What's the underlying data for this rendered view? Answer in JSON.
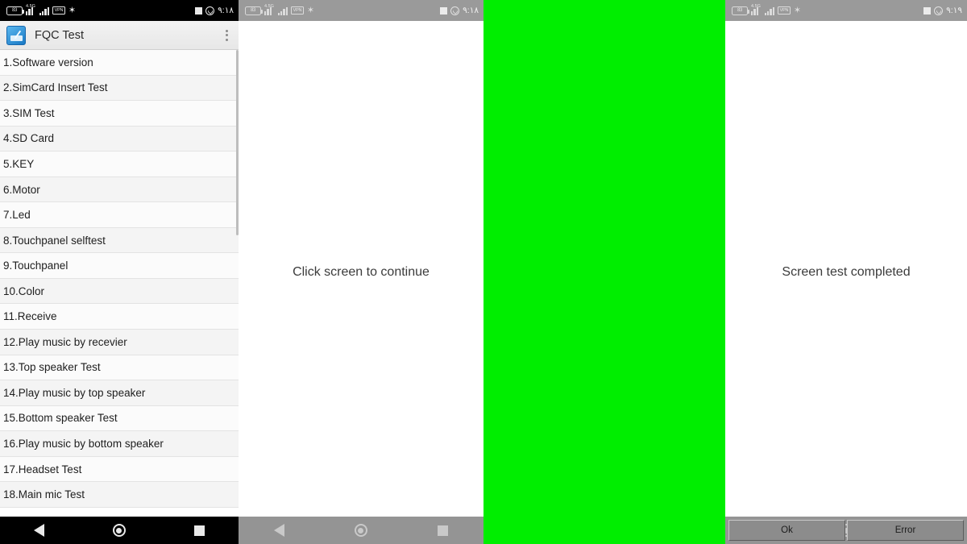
{
  "app": {
    "title": "FQC Test",
    "icon": "fqc-app-icon",
    "overflow_menu": "more-options"
  },
  "status_bar": {
    "battery_level": "83",
    "network_label": "4.5G",
    "vpn_label": "VPN",
    "bluetooth_icon": "bluetooth-icon",
    "notification_square": "notification-square-icon",
    "whatsapp_icon": "whatsapp-icon",
    "time_panel1": "٩:١٨",
    "time_panel2": "٩:١٨",
    "time_panel4": "٩:١٩"
  },
  "nav_bar": {
    "back": "back-nav",
    "home": "home-nav",
    "recents": "recents-nav"
  },
  "test_list": [
    "1.Software version",
    "2.SimCard Insert Test",
    "3.SIM Test",
    "4.SD Card",
    "5.KEY",
    "6.Motor",
    "7.Led",
    "8.Touchpanel selftest",
    "9.Touchpanel",
    "10.Color",
    "11.Receive",
    "12.Play music by recevier",
    "13.Top speaker Test",
    "14.Play music by top speaker",
    "15.Bottom speaker Test",
    "16.Play music by bottom speaker",
    "17.Headset Test",
    "18.Main mic Test"
  ],
  "panels": {
    "panel2": {
      "message": "Click screen to continue"
    },
    "panel3": {
      "fill_color": "#00ee00",
      "label": "green-color-test"
    },
    "panel4": {
      "message": "Screen test completed",
      "ok_label": "Ok",
      "error_label": "Error"
    }
  },
  "colors": {
    "status_dark": "#000000",
    "status_gray": "#9a9a9a",
    "nav_gray": "#949494",
    "green_test": "#00ee00",
    "list_row_a": "#fbfbfb",
    "list_row_b": "#f4f4f4"
  }
}
